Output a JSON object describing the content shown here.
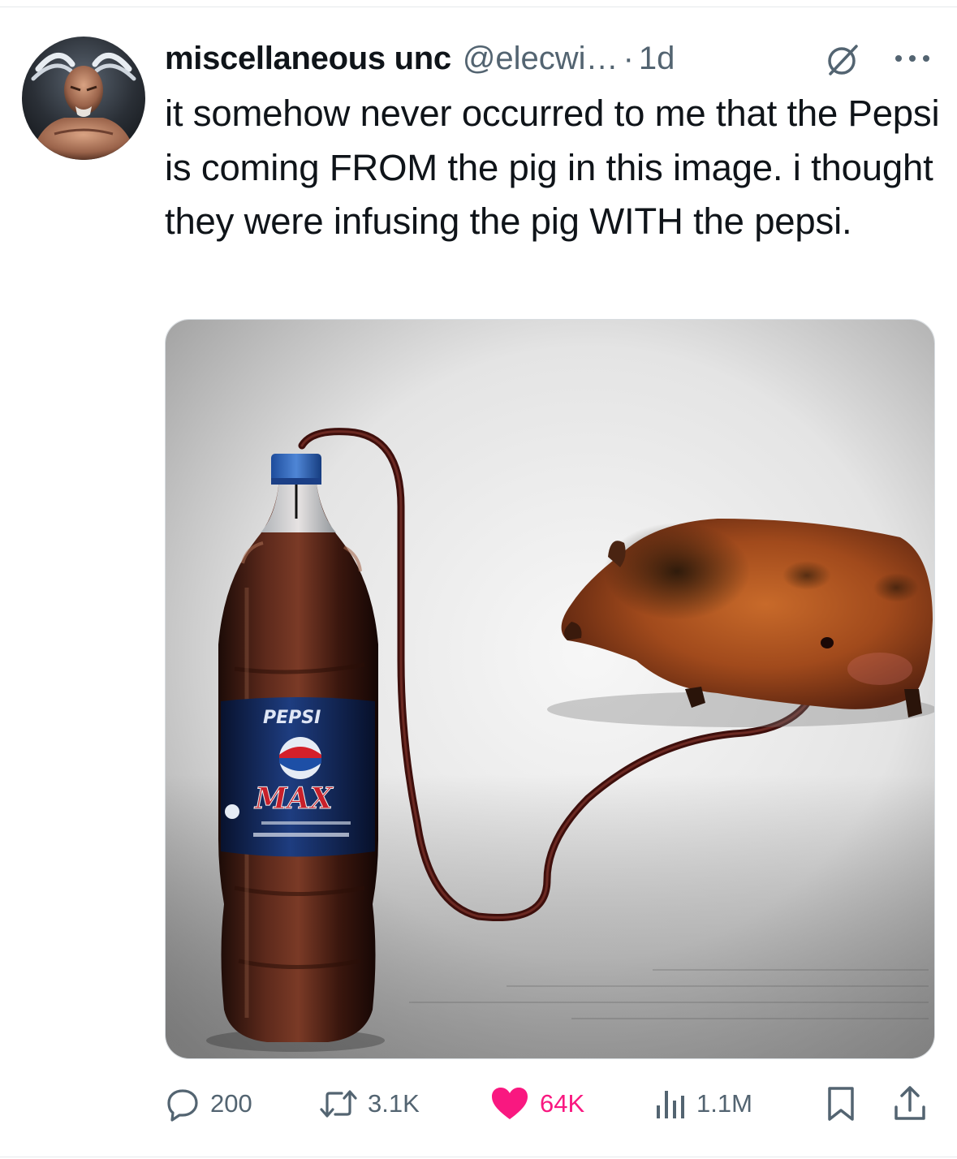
{
  "tweet": {
    "author": {
      "display_name": "miscellaneous unc",
      "handle": "@elecwi…",
      "time": "1d",
      "avatar_icon": "bald-fighter-avatar",
      "badge_icon": "slashed-circle-icon"
    },
    "text": "it somehow never occurred to me that the Pepsi is coming FROM the pig in this image. i thought they were infusing the pig WITH the pepsi.",
    "media": {
      "bottle_brand": "PEPSI",
      "bottle_product": "MAX"
    },
    "actions": {
      "replies": "200",
      "reposts": "3.1K",
      "likes": "64K",
      "views": "1.1M"
    },
    "colors": {
      "text_primary": "#0f1419",
      "text_secondary": "#536471",
      "like_active": "#f91880"
    }
  }
}
